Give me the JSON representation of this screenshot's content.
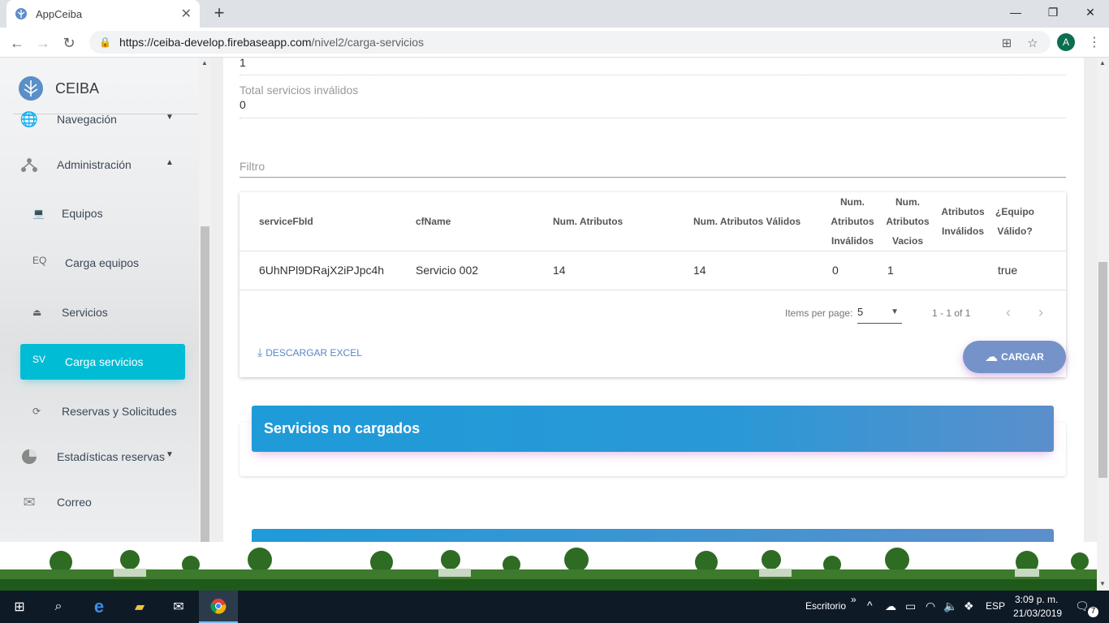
{
  "browser": {
    "tab_title": "AppCeiba",
    "url_host": "https://ceiba-develop.firebaseapp.com",
    "url_path": "/nivel2/carga-servicios",
    "avatar_letter": "A"
  },
  "sidebar": {
    "brand": "CEIBA",
    "items": [
      {
        "label": "Navegación"
      },
      {
        "label": "Administración"
      },
      {
        "abbr": "",
        "label": "Equipos"
      },
      {
        "abbr": "EQ",
        "label": "Carga equipos"
      },
      {
        "abbr": "",
        "label": "Servicios"
      },
      {
        "abbr": "SV",
        "label": "Carga servicios"
      },
      {
        "abbr": "",
        "label": "Reservas y Solicitudes"
      },
      {
        "label": "Estadísticas reservas"
      },
      {
        "label": "Correo"
      }
    ]
  },
  "summary": {
    "top_value": "1",
    "invalid_label": "Total servicios inválidos",
    "invalid_value": "0"
  },
  "filter": {
    "placeholder": "Filtro"
  },
  "table": {
    "headers": [
      "serviceFbId",
      "cfName",
      "Num. Atributos",
      "Num. Atributos Válidos",
      "Num.",
      "Atributos",
      "Inválidos",
      "Num.",
      "Atributos",
      "Vacios",
      "Atributos",
      "Inválidos",
      "¿Equipo",
      "Válido?"
    ],
    "rows": [
      [
        "6UhNPl9DRajX2iPJpc4h",
        "Servicio 002",
        "14",
        "14",
        "0",
        "1",
        "",
        "true"
      ]
    ],
    "items_per_page_label": "Items per page:",
    "items_per_page": "5",
    "range": "1 - 1 of 1"
  },
  "actions": {
    "excel": "DESCARGAR EXCEL",
    "cargar": "CARGAR"
  },
  "section": {
    "title": "Servicios no cargados"
  },
  "taskbar": {
    "desktop": "Escritorio",
    "lang": "ESP",
    "time": "3:09 p. m.",
    "date": "21/03/2019",
    "notif": "7"
  },
  "colors": {
    "accent": "#00bcd4",
    "header_blue": "#1e9bd8",
    "button": "#7593c9"
  }
}
